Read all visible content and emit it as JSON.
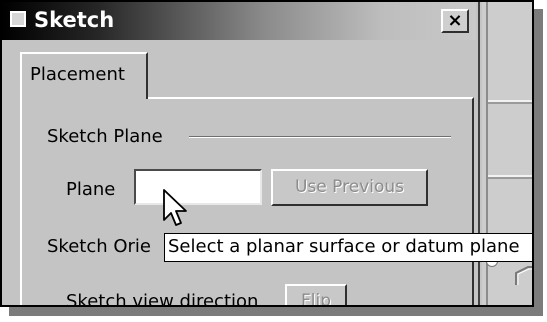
{
  "dialog": {
    "title": "Sketch",
    "close_glyph": "×",
    "tabs": [
      {
        "label": "Placement",
        "selected": true
      }
    ]
  },
  "sketch_plane": {
    "group_label": "Sketch Plane",
    "plane_label": "Plane",
    "plane_value": "",
    "use_previous_label": "Use Previous",
    "use_previous_enabled": false
  },
  "sketch_orientation": {
    "group_label_visible": "Sketch Orie",
    "view_direction_label": "Sketch view direction",
    "flip_label": "Flip",
    "flip_enabled": false
  },
  "tooltip": {
    "text": "Select a planar surface or datum plane"
  },
  "icons": {
    "title": "window-icon",
    "close": "close-icon",
    "cursor": "arrow-cursor-icon"
  },
  "colors": {
    "face": "#c4c4c4",
    "title_start": "#000000",
    "title_end": "#c9c9c9",
    "disabled_text": "#8c8c8c",
    "tooltip_bg": "#ffffff"
  }
}
